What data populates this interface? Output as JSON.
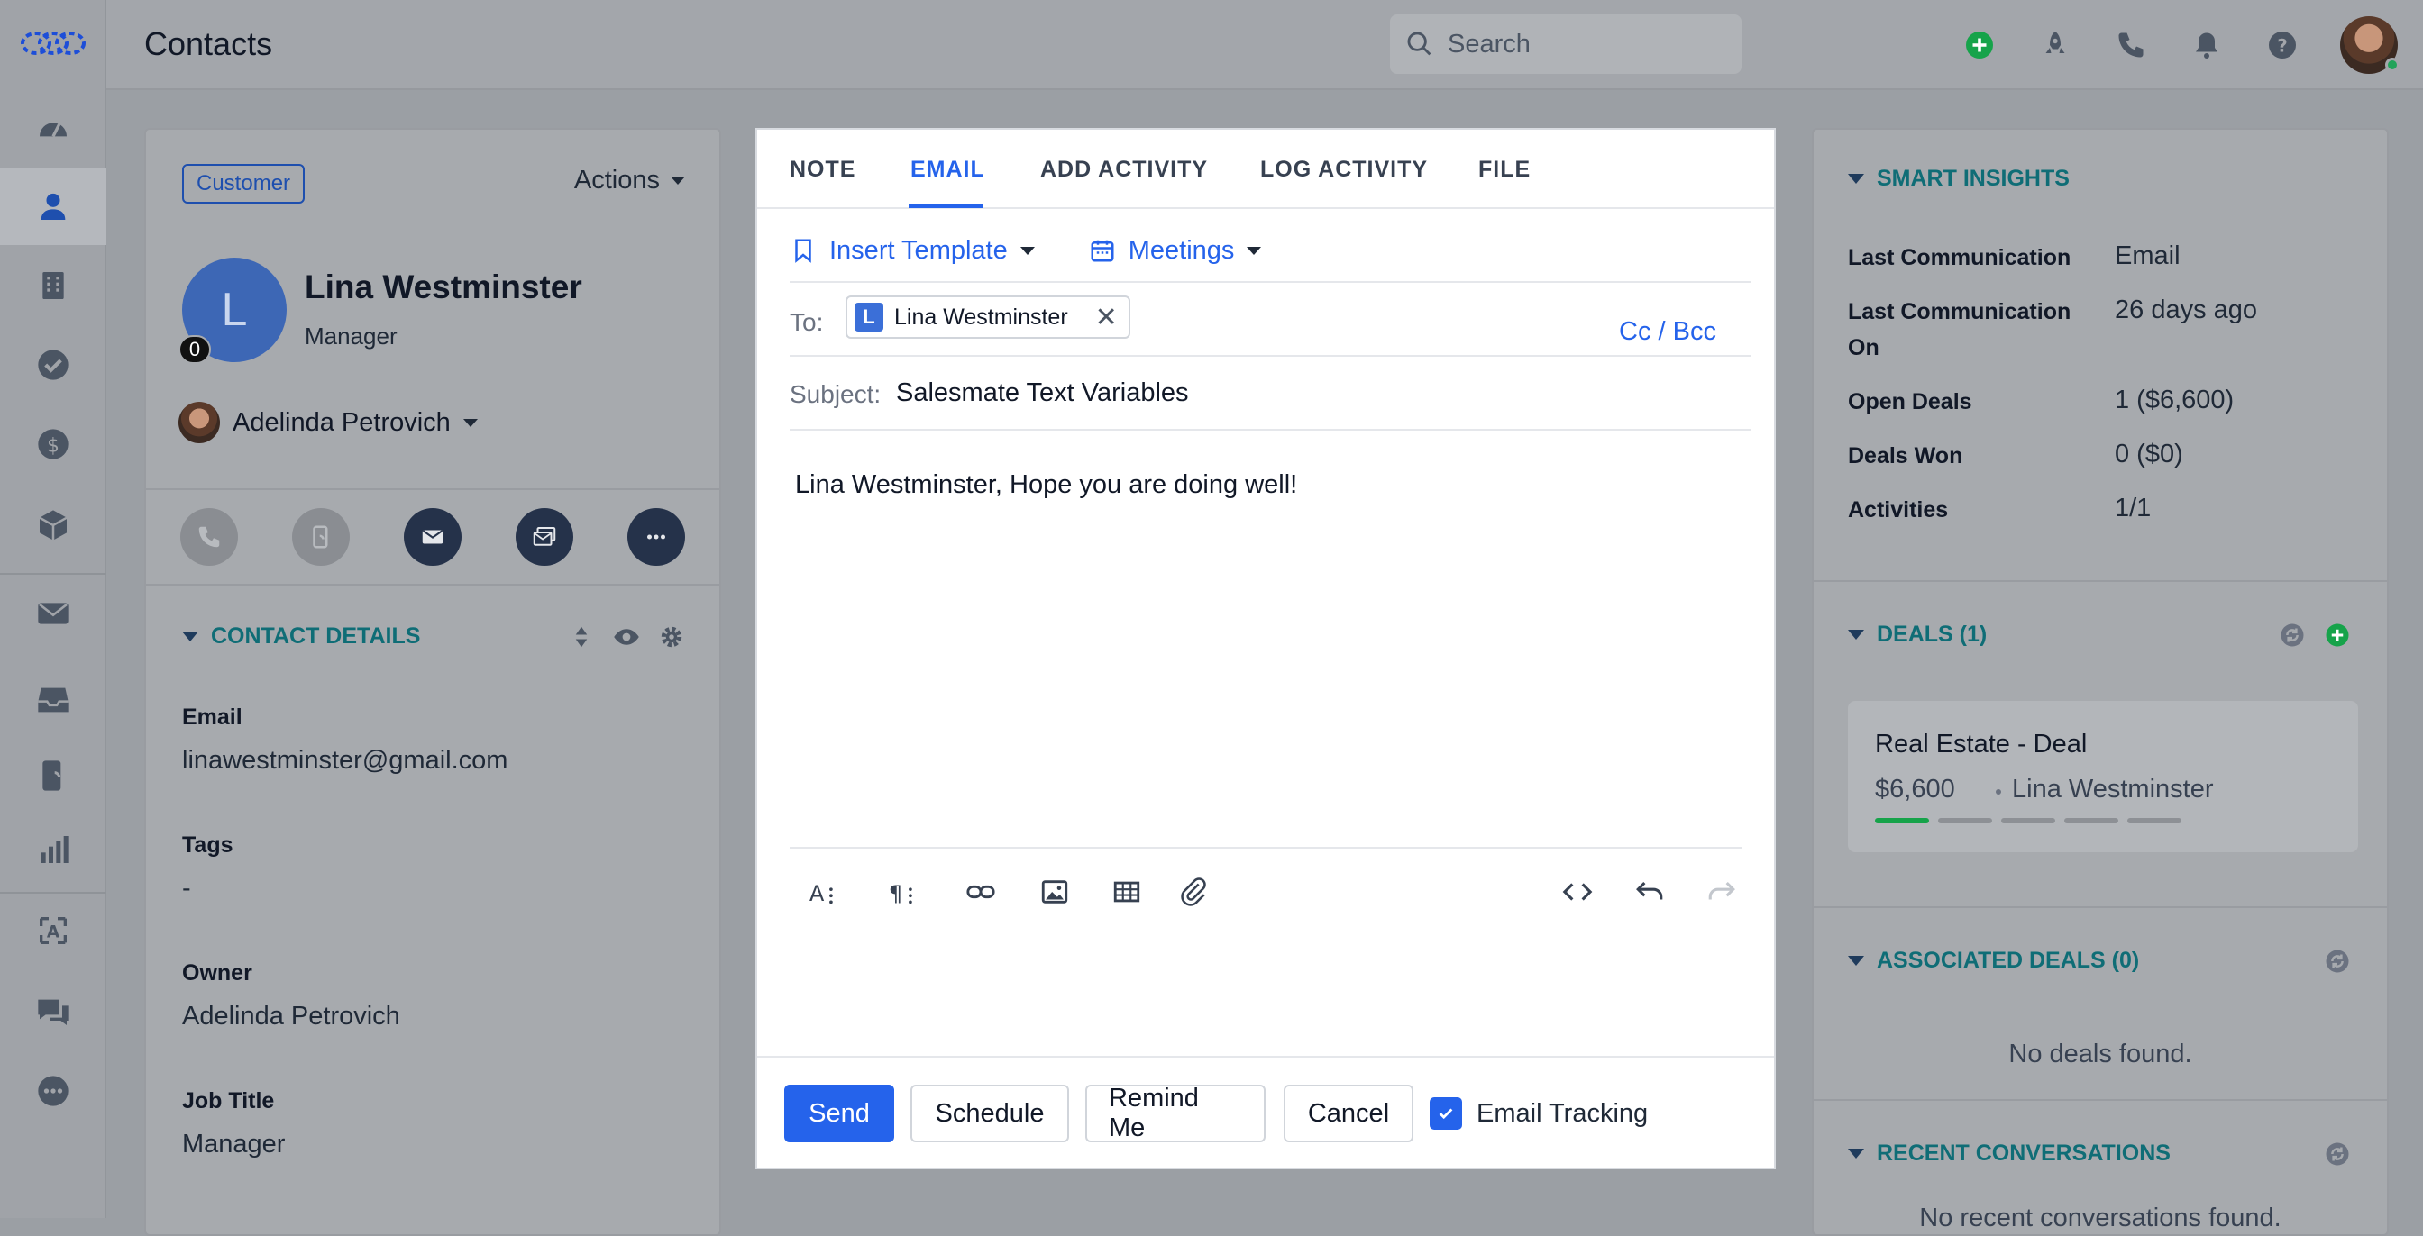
{
  "app": {
    "title": "Contacts"
  },
  "search": {
    "placeholder": "Search"
  },
  "contact": {
    "badge": "Customer",
    "actions_label": "Actions",
    "avatar_letter": "L",
    "avatar_count": "0",
    "name": "Lina Westminster",
    "role": "Manager",
    "owner": "Adelinda Petrovich"
  },
  "contact_details": {
    "title": "CONTACT DETAILS",
    "fields": [
      {
        "label": "Email",
        "value": "linawestminster@gmail.com"
      },
      {
        "label": "Tags",
        "value": "-"
      },
      {
        "label": "Owner",
        "value": "Adelinda Petrovich"
      },
      {
        "label": "Job Title",
        "value": "Manager"
      }
    ]
  },
  "composer": {
    "tabs": [
      "NOTE",
      "EMAIL",
      "ADD ACTIVITY",
      "LOG ACTIVITY",
      "FILE"
    ],
    "insert_template": "Insert Template",
    "meetings": "Meetings",
    "to_label": "To:",
    "recipient_letter": "L",
    "recipient": "Lina Westminster",
    "cc_bcc": "Cc / Bcc",
    "subject_label": "Subject:",
    "subject": "Salesmate Text Variables",
    "body": "Lina Westminster, Hope you are doing well!",
    "buttons": {
      "send": "Send",
      "schedule": "Schedule",
      "remind": "Remind Me",
      "cancel": "Cancel"
    },
    "tracking_label": "Email Tracking"
  },
  "insights": {
    "title": "SMART INSIGHTS",
    "rows": [
      {
        "label": "Last Communication",
        "value": "Email"
      },
      {
        "label": "Last Communication On",
        "value": "26 days ago"
      },
      {
        "label": "Open Deals",
        "value": "1 ($6,600)"
      },
      {
        "label": "Deals Won",
        "value": "0 ($0)"
      },
      {
        "label": "Activities",
        "value": "1/1"
      }
    ]
  },
  "deals": {
    "title": "DEALS (1)",
    "card": {
      "name": "Real Estate - Deal",
      "value": "$6,600",
      "contact": "Lina Westminster",
      "stages_total": 5,
      "stages_done": 1
    }
  },
  "associated_deals": {
    "title": "ASSOCIATED DEALS (0)",
    "empty": "No deals found."
  },
  "recent_conversations": {
    "title": "RECENT CONVERSATIONS",
    "empty": "No recent conversations found."
  },
  "colors": {
    "accent": "#2563eb",
    "teal": "#0f6d76",
    "success": "#16a34a"
  }
}
